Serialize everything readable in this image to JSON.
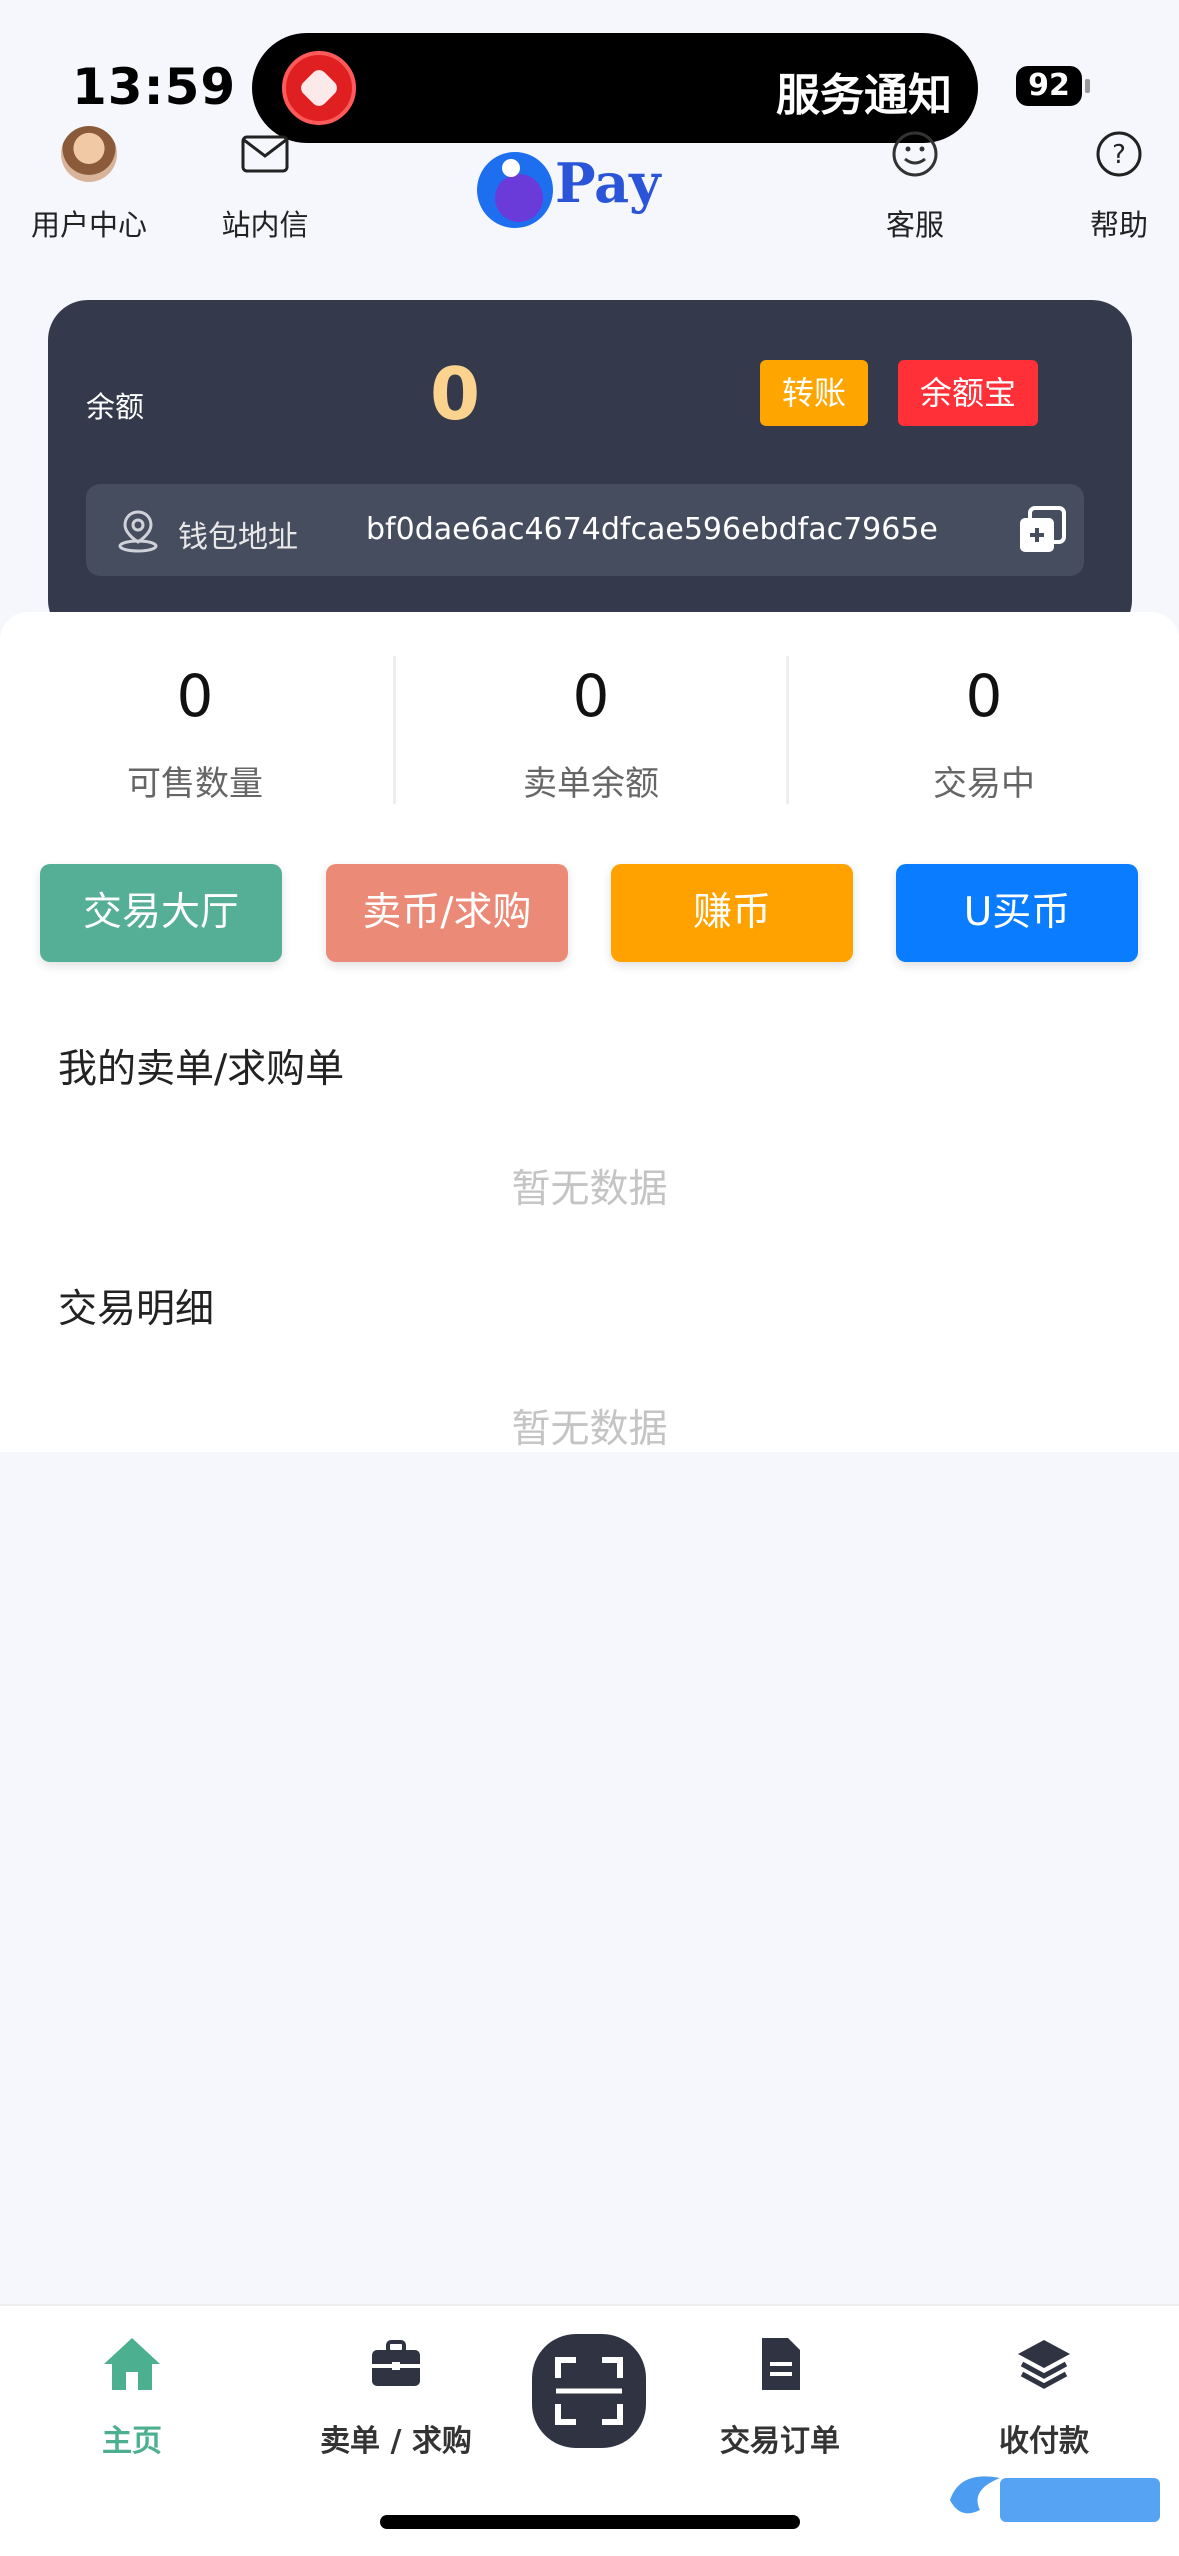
{
  "status_bar": {
    "time": "13:59",
    "notification_text": "服务通知",
    "battery": "92"
  },
  "header": {
    "user_center": "用户中心",
    "inbox": "站内信",
    "logo_text": "Pay",
    "support": "客服",
    "help": "帮助"
  },
  "wallet": {
    "balance_label": "余额",
    "balance_value": "0",
    "transfer_button": "转账",
    "yuebao_button": "余额宝",
    "address_label": "钱包地址",
    "address_value": "bf0dae6ac4674dfcae596ebdfac7965e"
  },
  "stats": [
    {
      "value": "0",
      "label": "可售数量"
    },
    {
      "value": "0",
      "label": "卖单余额"
    },
    {
      "value": "0",
      "label": "交易中"
    }
  ],
  "actions": [
    {
      "label": "交易大厅",
      "color": "#55ae96"
    },
    {
      "label": "卖币/求购",
      "color": "#ec8a78"
    },
    {
      "label": "赚币",
      "color": "#ffa200"
    },
    {
      "label": "U买币",
      "color": "#0a7cff"
    }
  ],
  "sections": {
    "my_orders_title": "我的卖单/求购单",
    "my_orders_empty": "暂无数据",
    "details_title": "交易明细",
    "details_empty": "暂无数据"
  },
  "tabbar": {
    "home": "主页",
    "sell_buy": "卖单 / 求购",
    "orders": "交易订单",
    "payments": "收付款"
  },
  "colors": {
    "accent": "#4caf8f",
    "card": "#343a4c",
    "balance": "#fbd38f"
  },
  "icons": [
    "avatar",
    "mail-icon",
    "support-icon",
    "help-icon",
    "location-icon",
    "copy-icon",
    "home-icon",
    "briefcase-icon",
    "scan-icon",
    "document-icon",
    "layers-icon"
  ]
}
